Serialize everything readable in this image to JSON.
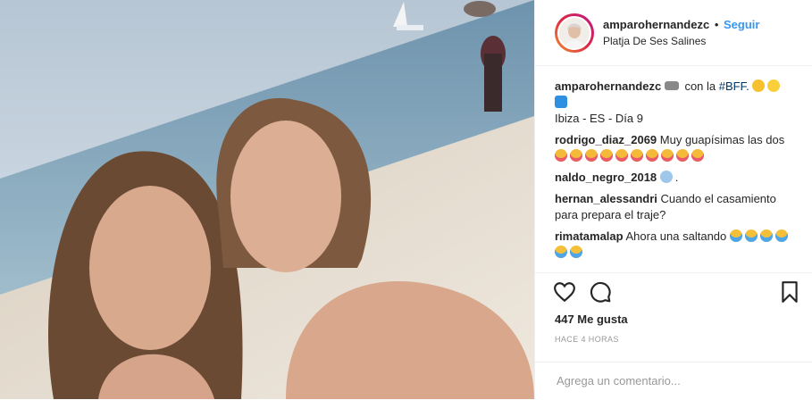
{
  "header": {
    "username": "amparohernandezc",
    "separator": "•",
    "follow_label": "Seguir",
    "location": "Platja De Ses Salines"
  },
  "caption": {
    "username": "amparohernandezc",
    "text_before": "con la",
    "hashtag": "#BFF.",
    "sub": "Ibiza - ES - Día 9"
  },
  "comments": [
    {
      "user": "rodrigo_diaz_2069",
      "text": "Muy guapísimas las dos",
      "emojis": 10,
      "emoji": "tongue-face-icon"
    },
    {
      "user": "naldo_negro_2018",
      "text": "",
      "emojis": 1,
      "emoji": "scream-face-icon",
      "trailing": "."
    },
    {
      "user": "hernan_alessandri",
      "text": "Cuando el casamiento para prepara el traje?",
      "emojis": 0
    },
    {
      "user": "rimatamalap",
      "text": "Ahora una saltando",
      "emojis": 6,
      "emoji": "laughing-face-icon"
    }
  ],
  "actions": {
    "like_icon": "heart-icon",
    "comment_icon": "comment-icon",
    "save_icon": "bookmark-icon"
  },
  "likes_label": "447 Me gusta",
  "time_label": "HACE 4 HORAS",
  "comment_placeholder": "Agrega un comentario...",
  "colors": {
    "link": "#3897f0",
    "muted": "#999999",
    "border": "#efefef"
  }
}
